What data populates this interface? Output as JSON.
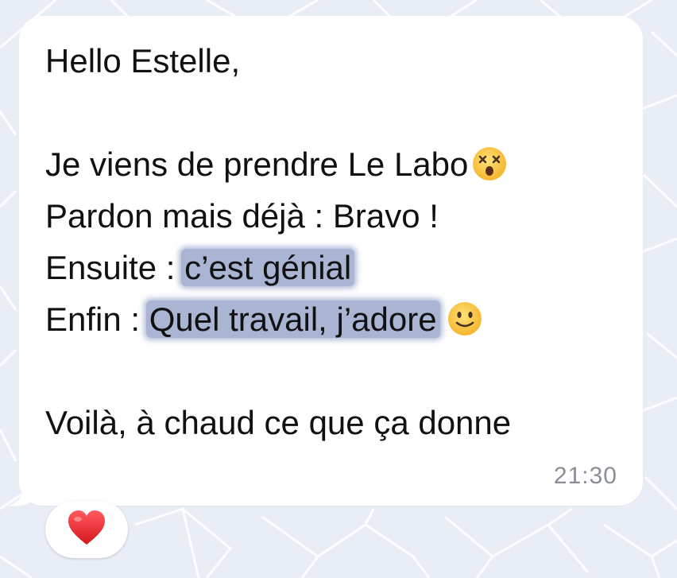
{
  "message": {
    "lines": [
      "Hello Estelle,",
      "",
      "Je viens de prendre Le Labo",
      "Pardon mais déjà : Bravo !",
      "Ensuite : ",
      "Enfin : ",
      "",
      "Voilà, à chaud ce que ça donne"
    ],
    "highlight_1": "c’est génial",
    "highlight_2": "Quel travail, j’adore",
    "time": "21:30"
  },
  "icons": {
    "emoji_1": "dizzy-face-emoji",
    "emoji_2": "slightly-smiling-face-emoji",
    "reaction": "red-heart-emoji"
  },
  "colors": {
    "background": "#e9eef6",
    "bubble": "#ffffff",
    "highlight": "#7688ba",
    "timestamp": "#8a8e96",
    "heart": "#e1262b"
  }
}
